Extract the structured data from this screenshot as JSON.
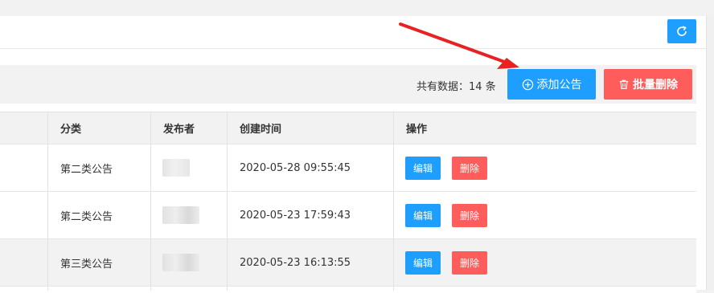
{
  "toolbar": {
    "count_label": "共有数据：",
    "count_value": "14",
    "count_unit": "条",
    "add_label": "添加公告",
    "batch_delete_label": "批量删除"
  },
  "table": {
    "columns": [
      "分类",
      "发布者",
      "创建时间",
      "操作"
    ],
    "rows": [
      {
        "category": "第二类公告",
        "created": "2020-05-28 09:55:45"
      },
      {
        "category": "第二类公告",
        "created": "2020-05-23 17:59:43"
      },
      {
        "category": "第三类公告",
        "created": "2020-05-23 16:13:55"
      }
    ],
    "edit_label": "编辑",
    "delete_label": "删除"
  },
  "colors": {
    "primary": "#1e9fff",
    "danger": "#ff5c5c",
    "annotation_arrow": "#e82222"
  },
  "icons": {
    "refresh": "refresh-icon",
    "add": "plus-circle-icon",
    "batch_delete": "trash-icon"
  }
}
